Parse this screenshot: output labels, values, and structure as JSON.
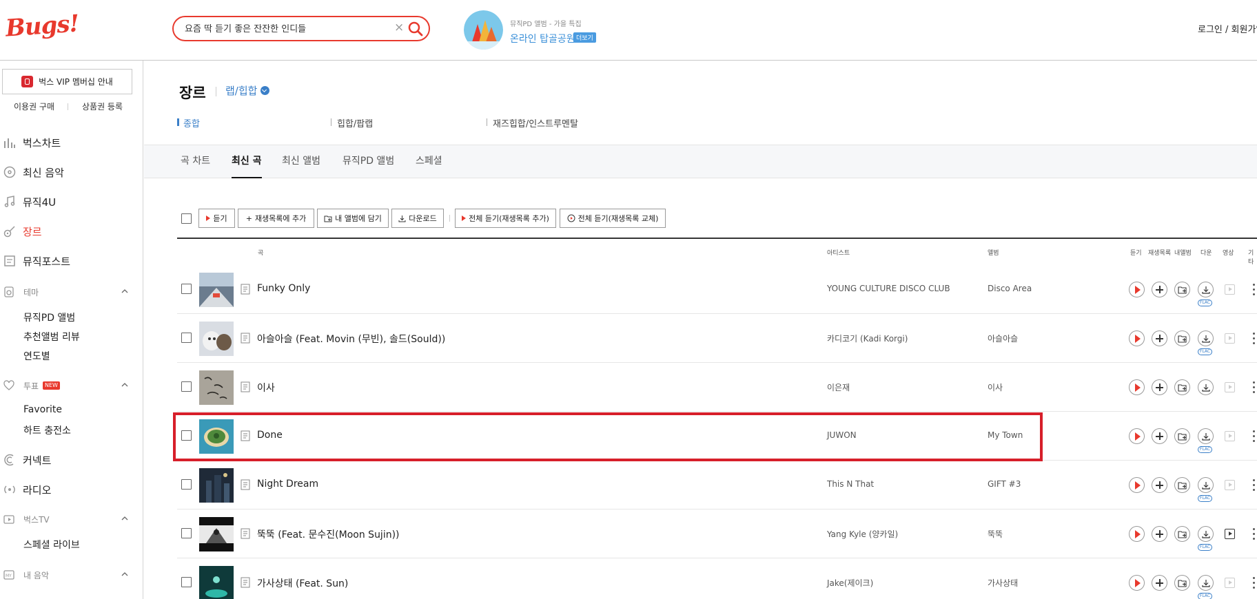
{
  "header": {
    "logo": "Bugs!",
    "search_value": "요즘 딱 듣기 좋은 잔잔한 인디들",
    "promo_label": "뮤직PD 앨범 - 가을 특집",
    "promo_title": "온라인 탑골공원",
    "promo_badge": "더보기",
    "auth_login": "로그인",
    "auth_sep": " / ",
    "auth_signup": "회원가입"
  },
  "sidebar": {
    "vip_label": "벅스 VIP 멤버십 안내",
    "buy_pass": "이용권 구매",
    "register_product": "상품권 등록",
    "nav": [
      {
        "label": "벅스차트",
        "icon": "chart-icon"
      },
      {
        "label": "최신 음악",
        "icon": "disc-icon"
      },
      {
        "label": "뮤직4U",
        "icon": "music-note-icon"
      },
      {
        "label": "장르",
        "icon": "guitar-icon"
      },
      {
        "label": "뮤직포스트",
        "icon": "post-icon"
      }
    ],
    "theme_label": "테마",
    "theme_items": [
      "뮤직PD 앨범",
      "추천앨범 리뷰",
      "연도별"
    ],
    "vote_label": "투표",
    "vote_badge": "NEW",
    "vote_items": [
      "Favorite",
      "하트 충전소"
    ],
    "connect_label": "커넥트",
    "radio_label": "라디오",
    "tv_label": "벅스TV",
    "tv_items": [
      "스페셜 라이브"
    ],
    "mymusic_label": "내 음악"
  },
  "main": {
    "title": "장르",
    "genre": "랩/힙합",
    "subgenres": [
      "종합",
      "힙합/팝랩",
      "재즈힙합/인스트루멘탈"
    ],
    "tabs": [
      "곡 차트",
      "최신 곡",
      "최신 앨범",
      "뮤직PD 앨범",
      "스페셜"
    ],
    "toolbar": {
      "play": "듣기",
      "add_playlist": "재생목록에 추가",
      "add_album": "내 앨범에 담기",
      "download": "다운로드",
      "play_all_add": "전체 듣기(재생목록 추가)",
      "play_all_replace": "전체 듣기(재생목록 교체)"
    },
    "columns": {
      "song": "곡",
      "artist": "아티스트",
      "album": "앨범",
      "listen": "듣기",
      "playlist": "재생목록",
      "myalbum": "내앨범",
      "download": "다운",
      "video": "영상",
      "etc": "기타"
    },
    "flac_label": "FLAC",
    "tracks": [
      {
        "title": "Funky Only",
        "artist": "YOUNG CULTURE DISCO CLUB",
        "album": "Disco Area",
        "flac": true,
        "video": false
      },
      {
        "title": "아슬아슬 (Feat. Movin (무빈), 솔드(Sould))",
        "artist": "카디코기 (Kadi Korgi)",
        "album": "아슬아슬",
        "flac": true,
        "video": false
      },
      {
        "title": "이사",
        "artist": "이은재",
        "album": "이사",
        "flac": false,
        "video": false
      },
      {
        "title": "Done",
        "artist": "JUWON",
        "album": "My Town",
        "flac": true,
        "video": false
      },
      {
        "title": "Night Dream",
        "artist": "This N That",
        "album": "GIFT #3",
        "flac": true,
        "video": false
      },
      {
        "title": "뚝뚝 (Feat. 문수진(Moon Sujin))",
        "artist": "Yang Kyle (양카일)",
        "album": "뚝뚝",
        "flac": true,
        "video": true
      },
      {
        "title": "가사상태 (Feat. Sun)",
        "artist": "Jake(제이크)",
        "album": "가사상태",
        "flac": true,
        "video": false
      }
    ]
  }
}
